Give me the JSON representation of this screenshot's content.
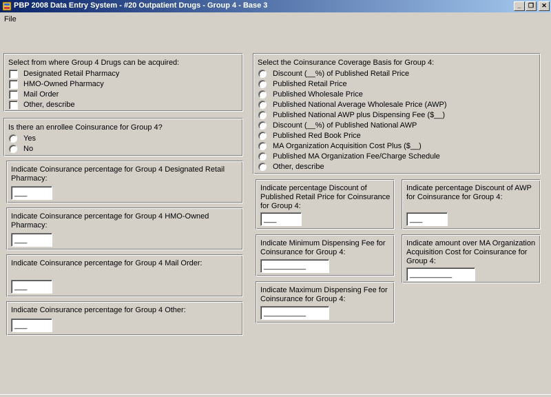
{
  "window": {
    "title": "PBP 2008 Data Entry System - #20 Outpatient Drugs - Group 4 - Base 3",
    "minimize_label": "_",
    "restore_label": "❐",
    "close_label": "✕"
  },
  "menu": {
    "file_label": "File"
  },
  "acquired": {
    "title": "Select from where Group 4 Drugs can be acquired:",
    "options": [
      "Designated Retail Pharmacy",
      "HMO-Owned Pharmacy",
      "Mail Order",
      "Other, describe"
    ]
  },
  "enrollee": {
    "title": "Is there an enrollee Coinsurance for Group 4?",
    "options": [
      "Yes",
      "No"
    ]
  },
  "coins_retail": {
    "label": "Indicate Coinsurance percentage for Group 4 Designated Retail Pharmacy:",
    "value": "___"
  },
  "coins_hmo": {
    "label": "Indicate Coinsurance percentage for Group 4 HMO-Owned Pharmacy:",
    "value": "___"
  },
  "coins_mail": {
    "label": "Indicate Coinsurance percentage for Group 4 Mail Order:",
    "value": "___"
  },
  "coins_other": {
    "label": "Indicate Coinsurance percentage for Group 4 Other:",
    "value": "___"
  },
  "basis": {
    "title": "Select the Coinsurance Coverage Basis for Group 4:",
    "options": [
      "Discount (__%) of Published Retail Price",
      "Published Retail Price",
      "Published Wholesale Price",
      "Published National Average Wholesale Price (AWP)",
      "Published National AWP plus Dispensing Fee ($__)",
      "Discount (__%) of Published National AWP",
      "Published Red Book Price",
      "MA Organization Acquisition Cost Plus ($__)",
      "Published MA Organization Fee/Charge Schedule",
      "Other, describe"
    ]
  },
  "discount_retail": {
    "label": "Indicate percentage Discount of Published Retail Price for Coinsurance for Group 4:",
    "value": "___"
  },
  "discount_awp": {
    "label": "Indicate percentage Discount of AWP for Coinsurance for Group 4:",
    "value": "___"
  },
  "min_fee": {
    "label": "Indicate Minimum Dispensing Fee for Coinsurance for Group 4:",
    "value": "__________"
  },
  "max_fee": {
    "label": "Indicate Maximum Dispensing Fee for Coinsurance for Group 4:",
    "value": "__________"
  },
  "over_cost": {
    "label": "Indicate amount over MA Organization Acquisition Cost for Coinsurance for Group 4:",
    "value": "__________"
  }
}
